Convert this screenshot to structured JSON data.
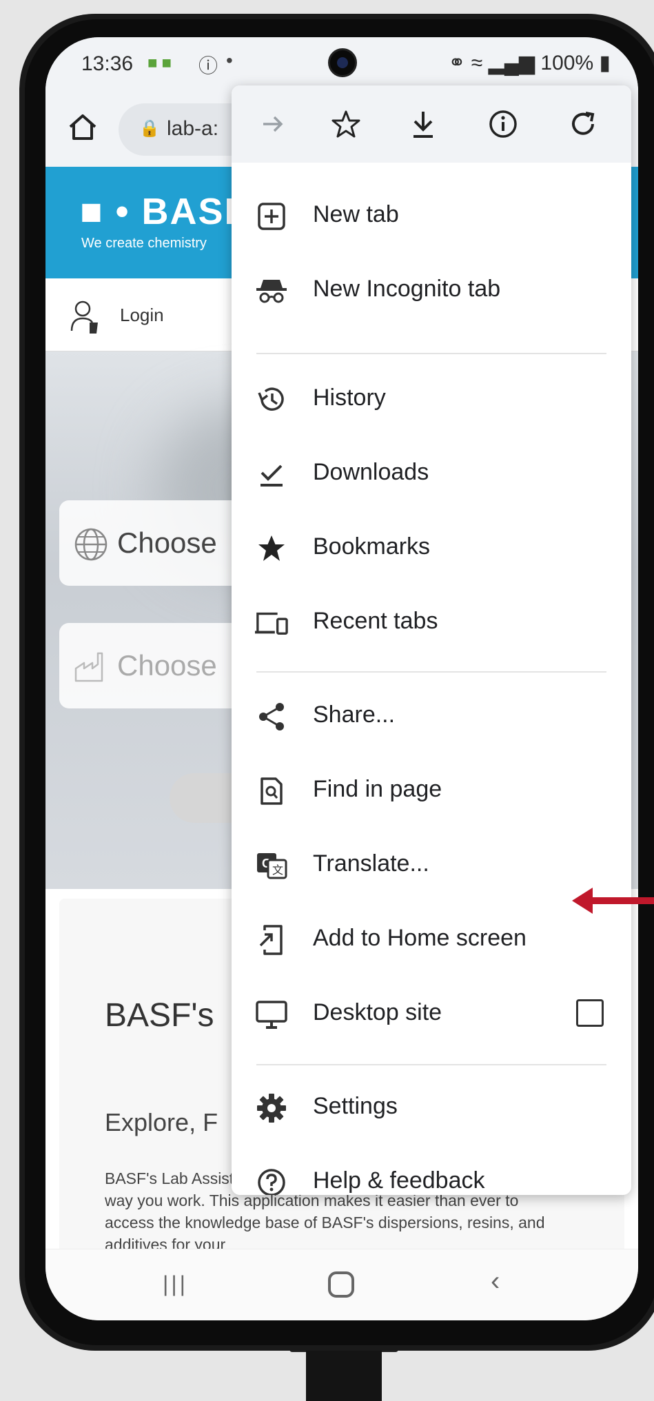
{
  "status_bar": {
    "time": "13:36",
    "battery": "100%"
  },
  "url_bar": {
    "url": "lab-a:"
  },
  "page": {
    "logo_text": "■ • BASF",
    "tagline": "We create chemistry",
    "login_label": "Login",
    "choose_label_1": "Choose",
    "choose_label_2": "Choose",
    "title": "BASF's",
    "subtitle": "Explore, F",
    "body": "BASF's Lab Assistant is a powerful digital tool that changes the way you work. This application makes it easier than ever to access the knowledge base of BASF's dispersions, resins, and additives for your"
  },
  "menu": {
    "toolbar": [
      "forward-icon",
      "star-icon",
      "download-icon",
      "info-icon",
      "refresh-icon"
    ],
    "items": [
      {
        "label": "New tab",
        "icon": "new-tab-icon"
      },
      {
        "label": "New Incognito tab",
        "icon": "incognito-icon"
      },
      {
        "label": "History",
        "icon": "history-icon"
      },
      {
        "label": "Downloads",
        "icon": "downloads-icon"
      },
      {
        "label": "Bookmarks",
        "icon": "bookmarks-icon"
      },
      {
        "label": "Recent tabs",
        "icon": "recent-tabs-icon"
      },
      {
        "label": "Share...",
        "icon": "share-icon"
      },
      {
        "label": "Find in page",
        "icon": "find-in-page-icon"
      },
      {
        "label": "Translate...",
        "icon": "translate-icon"
      },
      {
        "label": "Add to Home screen",
        "icon": "add-to-home-icon"
      },
      {
        "label": "Desktop site",
        "icon": "desktop-icon"
      },
      {
        "label": "Settings",
        "icon": "settings-icon"
      },
      {
        "label": "Help & feedback",
        "icon": "help-icon"
      }
    ]
  },
  "colors": {
    "banner": "#21a0d2",
    "arrow": "#c0182b"
  }
}
